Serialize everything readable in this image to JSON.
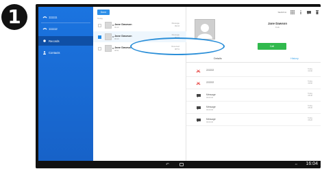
{
  "step_badge": "1",
  "sidebar": {
    "items": [
      {
        "label": "111111",
        "icon": "phone-icon"
      },
      {
        "label": "111112",
        "icon": "phone-icon"
      },
      {
        "label": "Records",
        "icon": "record-dot-icon",
        "active": true
      },
      {
        "label": "Contacts",
        "icon": "person-icon"
      }
    ]
  },
  "list": {
    "done_label": "Done",
    "section_header": "Today",
    "rows": [
      {
        "name": "Jane Dawson",
        "subtitle": "09:10",
        "time": [
          "Message",
          "09:10"
        ],
        "checked": false
      },
      {
        "name": "Jane Dawson",
        "subtitle": "09:10",
        "time": [
          "Message",
          "09:10"
        ],
        "checked": true
      },
      {
        "name": "Jane Dawson",
        "subtitle": "08:51",
        "time": [
          "Received",
          "08:51"
        ],
        "checked": false
      }
    ]
  },
  "detail": {
    "toolbar": {
      "search_label": "SEARCH"
    },
    "contact_name": "Jane Dawson",
    "contact_sub": "6 sb",
    "call_label": "Call",
    "tabs": {
      "details": "Details",
      "history": "History"
    },
    "history": [
      {
        "icon": "missed-call-icon",
        "title": "222222",
        "sub": "",
        "time": [
          "Today",
          "09:00"
        ]
      },
      {
        "icon": "missed-call-icon",
        "title": "222222",
        "sub": "",
        "time": [
          "Today",
          "08:50"
        ]
      },
      {
        "icon": "message-icon",
        "title": "Message",
        "sub": "09:00:00",
        "time": [
          "Today",
          "08:40"
        ]
      },
      {
        "icon": "message-icon",
        "title": "Message",
        "sub": "09:00:00",
        "time": [
          "Today",
          "08:30"
        ]
      },
      {
        "icon": "message-icon",
        "title": "Message",
        "sub": "09:00:00",
        "time": [
          "Today",
          "08:20"
        ]
      }
    ]
  },
  "navbar": {
    "clock": "16:04",
    "status": "40"
  },
  "colors": {
    "sidebar": "#1762c8",
    "accent": "#2d8fe8",
    "call": "#31b94d",
    "highlight": "#2a8ed8"
  }
}
